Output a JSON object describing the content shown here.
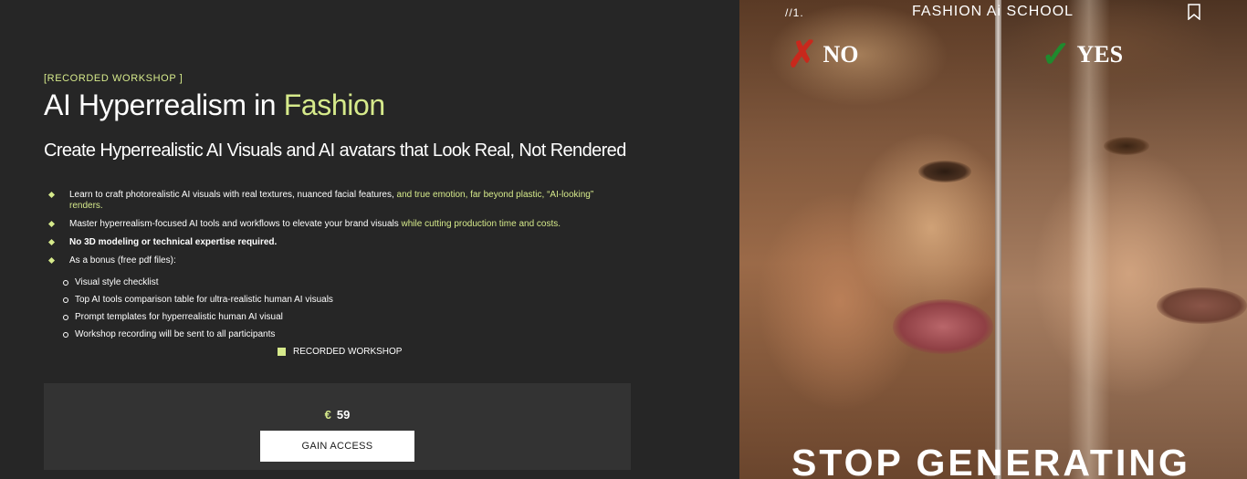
{
  "workshop": {
    "eyebrow": "[RECORDED WORKSHOP ]",
    "title_prefix": "AI Hyperrealism in ",
    "title_accent": "Fashion",
    "subtitle": "Create Hyperrealistic AI Visuals and AI avatars that Look Real, Not Rendered",
    "bullets": [
      {
        "text": "Learn to craft photorealistic AI visuals with real textures, nuanced facial features, ",
        "highlight": "and true emotion, far beyond plastic, “AI-looking” renders."
      },
      {
        "text": "Master hyperrealism-focused AI tools and workflows to elevate your brand visuals ",
        "highlight": "while cutting production time and costs."
      },
      {
        "text": "No 3D modeling or technical expertise required.",
        "highlight": ""
      },
      {
        "text": "As a bonus (free pdf files):",
        "highlight": ""
      }
    ],
    "bonus_items": [
      "Visual style checklist",
      "Top AI tools comparison table for ultra-realistic human AI visuals",
      "Prompt templates for hyperrealistic human AI visual",
      "Workshop recording will be sent to all participants"
    ],
    "tag": "RECORDED WORKSHOP",
    "price": {
      "currency": "€",
      "amount": "59"
    },
    "cta_label": "GAIN ACCESS"
  },
  "hero": {
    "number": "//1.",
    "brand": "FASHION Ai SCHOOL",
    "no_mark": "✗",
    "no_label": "NO",
    "yes_mark": "✓",
    "yes_label": "YES",
    "bottom_text": "STOP GENERATING"
  },
  "colors": {
    "background": "#262626",
    "accent": "#d6ea8b",
    "price_box": "#333333",
    "cta_bg": "#ffffff"
  }
}
